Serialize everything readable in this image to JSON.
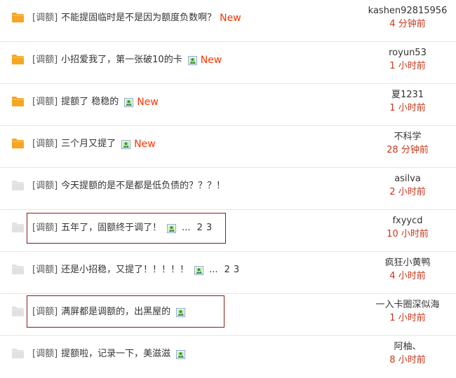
{
  "threads": [
    {
      "tag": "[调额]",
      "title": "不能提固临时是不是因为额度负数啊？",
      "has_image": false,
      "new_label": "New",
      "pages": [],
      "author": "kashen92815956",
      "time": "4 分钟前",
      "folder": "hot"
    },
    {
      "tag": "[调额]",
      "title": "小招爱我了，第一张破10的卡",
      "has_image": true,
      "new_label": "New",
      "pages": [],
      "author": "royun53",
      "time": "1 小时前",
      "folder": "hot"
    },
    {
      "tag": "[调额]",
      "title": "提额了 稳稳的",
      "has_image": true,
      "new_label": "New",
      "pages": [],
      "author": "夏1231",
      "time": "1 小时前",
      "folder": "hot"
    },
    {
      "tag": "[调额]",
      "title": "三个月又提了",
      "has_image": true,
      "new_label": "New",
      "pages": [],
      "author": "不科学",
      "time": "28 分钟前",
      "folder": "hot"
    },
    {
      "tag": "[调额]",
      "title": "今天提额的是不是都是低负债的？？？！",
      "has_image": false,
      "new_label": "",
      "pages": [],
      "author": "asilva",
      "time": "2 小时前",
      "folder": "normal"
    },
    {
      "tag": "[调额]",
      "title": "五年了，固额终于调了！",
      "has_image": true,
      "new_label": "",
      "pages": [
        "2",
        "3"
      ],
      "pages_dots": "...",
      "author": "fxyycd",
      "time": "10 小时前",
      "folder": "normal"
    },
    {
      "tag": "[调额]",
      "title": "还是小招稳，又提了！！！！！",
      "has_image": true,
      "new_label": "",
      "pages": [
        "2",
        "3"
      ],
      "pages_dots": "...",
      "author": "疯狂小黄鸭",
      "time": "4 小时前",
      "folder": "normal"
    },
    {
      "tag": "[调额]",
      "title": "满屏都是调额的，出黑屋的",
      "has_image": true,
      "new_label": "",
      "pages": [],
      "author": "一入卡圈深似海",
      "time": "1 小时前",
      "folder": "normal"
    },
    {
      "tag": "[调额]",
      "title": "提额啦，记录一下，美滋滋",
      "has_image": true,
      "new_label": "",
      "pages": [],
      "author": "阿柚、",
      "time": "8 小时前",
      "folder": "normal"
    }
  ],
  "colors": {
    "folder_hot": "#f5a623",
    "folder_normal": "#e1e1e1",
    "new": "#ff3300",
    "time": "#c8361c",
    "highlight_border": "#8b1a1a"
  },
  "icons": {
    "folder": "folder-icon",
    "image": "image-attachment-icon"
  }
}
